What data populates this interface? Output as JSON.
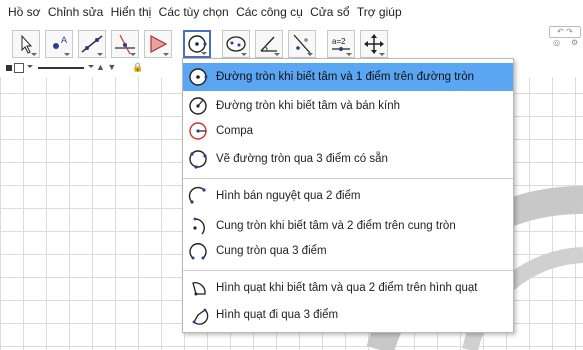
{
  "menu": {
    "items": [
      "Hồ sơ",
      "Chỉnh sửa",
      "Hiển thị",
      "Các tùy chọn",
      "Các công cụ",
      "Cửa sổ",
      "Trợ giúp"
    ]
  },
  "toolbar": {
    "tools": [
      {
        "name": "move-tool-icon"
      },
      {
        "name": "point-tool-icon"
      },
      {
        "name": "line-tool-icon"
      },
      {
        "name": "perpendicular-line-tool-icon"
      },
      {
        "name": "polygon-tool-icon"
      },
      {
        "name": "circle-tool-icon",
        "active": true
      },
      {
        "name": "ellipse-tool-icon"
      },
      {
        "name": "angle-tool-icon"
      },
      {
        "name": "reflect-tool-icon"
      },
      {
        "name": "slider-tool-icon",
        "text": "a=2"
      },
      {
        "name": "move-view-tool-icon"
      }
    ],
    "accent": "#4a6fc0"
  },
  "stylebar": {
    "line_label": "▲ ▼"
  },
  "dropdown": {
    "highlight_color": "#5ba6f2",
    "items": [
      {
        "label": "Đường tròn khi biết tâm và 1 điểm trên đường tròn",
        "icon": "circle-center-point-icon"
      },
      {
        "label": "Đường tròn khi biết tâm và bán kính",
        "icon": "circle-center-radius-icon"
      },
      {
        "label": "Compa",
        "icon": "compass-icon"
      },
      {
        "label": "Vẽ đường tròn qua 3 điểm có sẵn",
        "icon": "circle-three-points-icon"
      },
      {
        "label": "Hình bán nguyệt qua 2 điểm",
        "icon": "semicircle-icon"
      },
      {
        "label": "Cung tròn khi biết tâm và 2 điểm trên cung tròn",
        "icon": "arc-center-icon"
      },
      {
        "label": "Cung tròn qua 3 điểm",
        "icon": "arc-three-points-icon"
      },
      {
        "label": "Hình quạt khi biết tâm và qua 2 điểm trên hình quạt",
        "icon": "sector-center-icon"
      },
      {
        "label": "Hình quạt đi qua 3 điểm",
        "icon": "sector-three-points-icon"
      }
    ]
  }
}
